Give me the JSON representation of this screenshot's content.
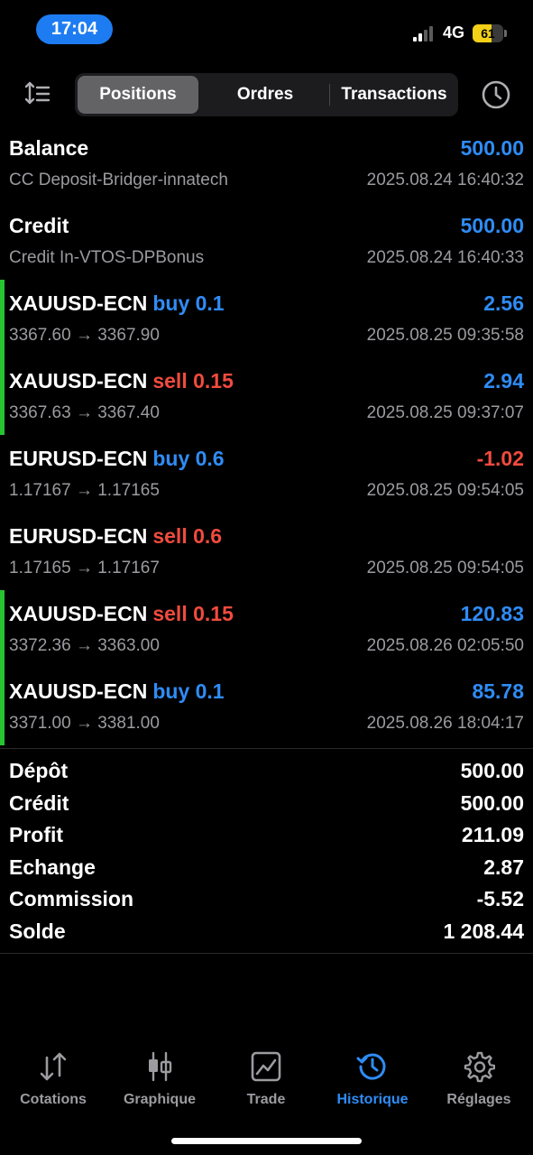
{
  "status_bar": {
    "time": "17:04",
    "network": "4G",
    "battery": "61",
    "battery_level": 0.61
  },
  "tabs": [
    "Positions",
    "Ordres",
    "Transactions"
  ],
  "active_tab": "Positions",
  "rows": [
    {
      "title": "Balance",
      "side": "",
      "volume": "",
      "value": "500.00",
      "sub": "CC Deposit-Bridger-innatech",
      "date": "2025.08.24 16:40:32"
    },
    {
      "title": "Credit",
      "side": "",
      "volume": "",
      "value": "500.00",
      "sub": "Credit In-VTOS-DPBonus",
      "date": "2025.08.24 16:40:33"
    },
    {
      "title": "XAUUSD-ECN",
      "side": "buy",
      "volume": "0.1",
      "value": "2.56",
      "sub": "3367.60 → 3367.90",
      "date": "2025.08.25 09:35:58"
    },
    {
      "title": "XAUUSD-ECN",
      "side": "sell",
      "volume": "0.15",
      "value": "2.94",
      "sub": "3367.63 → 3367.40",
      "date": "2025.08.25 09:37:07"
    },
    {
      "title": "EURUSD-ECN",
      "side": "buy",
      "volume": "0.6",
      "value": "-1.02",
      "sub": "1.17167 → 1.17165",
      "date": "2025.08.25 09:54:05"
    },
    {
      "title": "EURUSD-ECN",
      "side": "sell",
      "volume": "0.6",
      "value": "",
      "sub": "1.17165 → 1.17167",
      "date": "2025.08.25 09:54:05"
    },
    {
      "title": "XAUUSD-ECN",
      "side": "sell",
      "volume": "0.15",
      "value": "120.83",
      "sub": "3372.36 → 3363.00",
      "date": "2025.08.26 02:05:50"
    },
    {
      "title": "XAUUSD-ECN",
      "side": "buy",
      "volume": "0.1",
      "value": "85.78",
      "sub": "3371.00 → 3381.00",
      "date": "2025.08.26 18:04:17"
    }
  ],
  "summary": [
    {
      "label": "Dépôt",
      "value": "500.00"
    },
    {
      "label": "Crédit",
      "value": "500.00"
    },
    {
      "label": "Profit",
      "value": "211.09"
    },
    {
      "label": "Echange",
      "value": "2.87"
    },
    {
      "label": "Commission",
      "value": "-5.52"
    },
    {
      "label": "Solde",
      "value": "1 208.44"
    }
  ],
  "bottom_nav": [
    {
      "label": "Cotations",
      "icon": "quotes-arrows-icon"
    },
    {
      "label": "Graphique",
      "icon": "candlestick-icon"
    },
    {
      "label": "Trade",
      "icon": "trade-chart-icon"
    },
    {
      "label": "Historique",
      "icon": "history-clock-icon"
    },
    {
      "label": "Réglages",
      "icon": "gear-icon"
    }
  ],
  "active_nav": "Historique",
  "colors": {
    "accent": "#2f8cf5",
    "sell": "#f14b3e",
    "profit_bar": "#26c431",
    "status_pill": "#1e7cf2",
    "battery": "#f4d017"
  }
}
